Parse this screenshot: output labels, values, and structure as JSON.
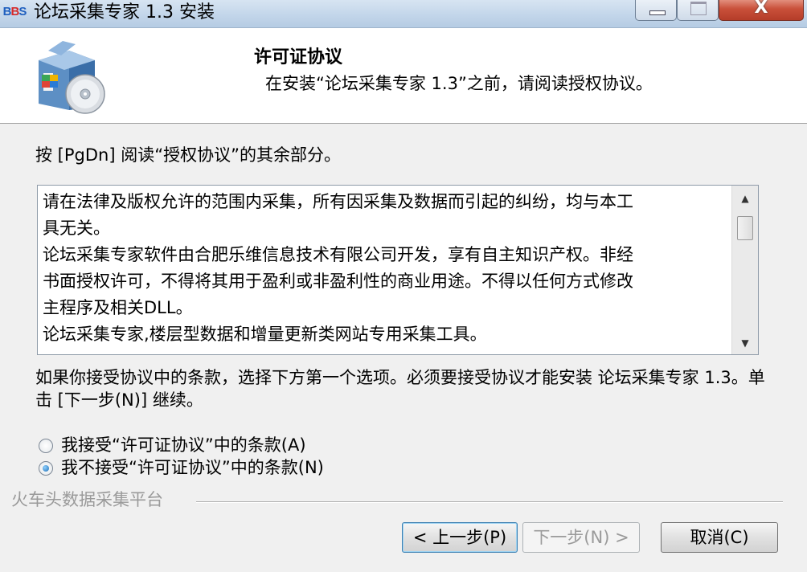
{
  "window": {
    "icon_text": "BBS",
    "title": "论坛采集专家 1.3 安装",
    "close_glyph": "X"
  },
  "header": {
    "title": "许可证协议",
    "subtitle": "在安装“论坛采集专家 1.3”之前，请阅读授权协议。"
  },
  "instruction": "按 [PgDn] 阅读“授权协议”的其余部分。",
  "license": {
    "lines": [
      "请在法律及版权允许的范围内采集，所有因采集及数据而引起的纠纷，均与本工",
      "具无关。",
      "论坛采集专家软件由合肥乐维信息技术有限公司开发，享有自主知识产权。非经",
      "书面授权许可，不得将其用于盈利或非盈利性的商业用途。不得以任何方式修改",
      "主程序及相关DLL。",
      "论坛采集专家,楼层型数据和增量更新类网站专用采集工具。"
    ]
  },
  "terms_notice": "如果你接受协议中的条款，选择下方第一个选项。必须要接受协议才能安装 论坛采集专家 1.3。单击 [下一步(N)] 继续。",
  "options": {
    "accept_label": "我接受“许可证协议”中的条款(A)",
    "decline_label": "我不接受“许可证协议”中的条款(N)",
    "selected": "decline"
  },
  "branding": "火车头数据采集平台",
  "buttons": {
    "back_label": "< 上一步(P)",
    "next_label": "下一步(N) >",
    "cancel_label": "取消(C)"
  }
}
